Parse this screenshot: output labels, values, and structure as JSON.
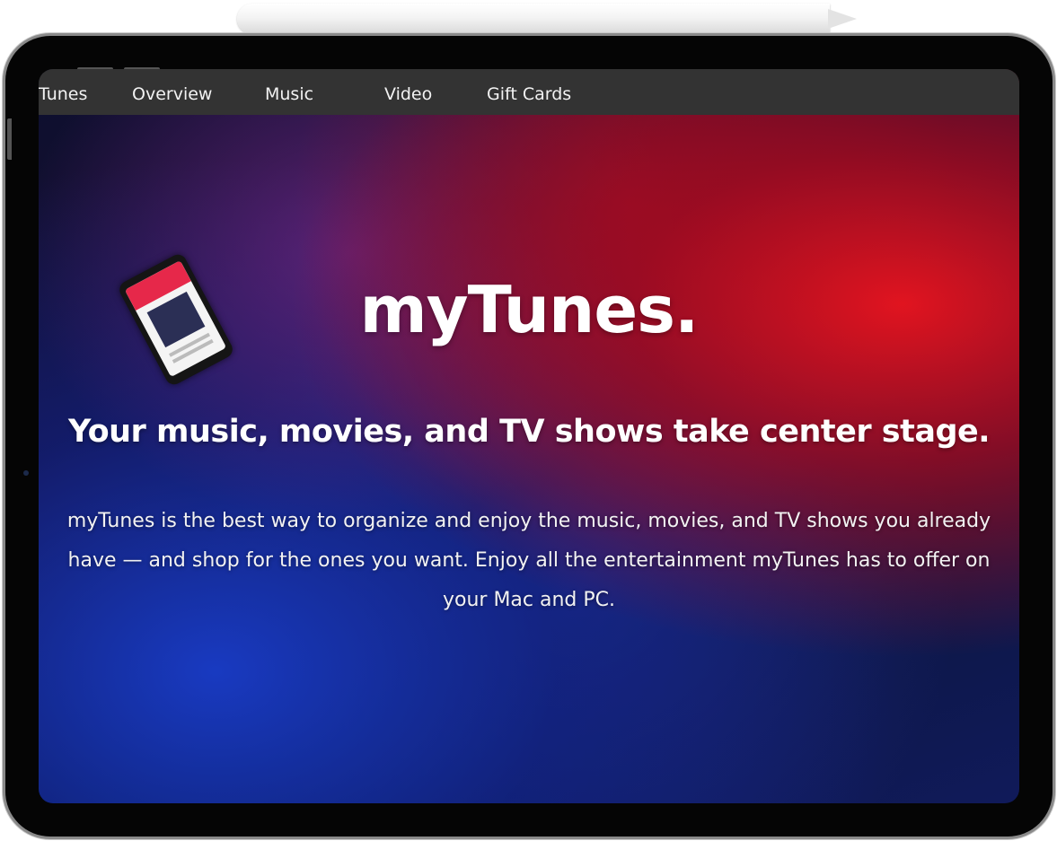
{
  "nav": {
    "items": [
      {
        "label": "Tunes"
      },
      {
        "label": "Overview"
      },
      {
        "label": "Music"
      },
      {
        "label": "Video"
      },
      {
        "label": "Gift Cards"
      }
    ]
  },
  "hero": {
    "title": "myTunes.",
    "subtitle": "Your music, movies, and TV shows take center stage.",
    "body": "myTunes is the best way to organize and enjoy the music, movies, and TV shows you already have — and shop for the ones you want. Enjoy all the entertainment myTunes has to offer on your Mac and PC."
  },
  "colors": {
    "navbar_bg": "#333333",
    "text": "#ffffff",
    "device_frame": "#050505"
  }
}
